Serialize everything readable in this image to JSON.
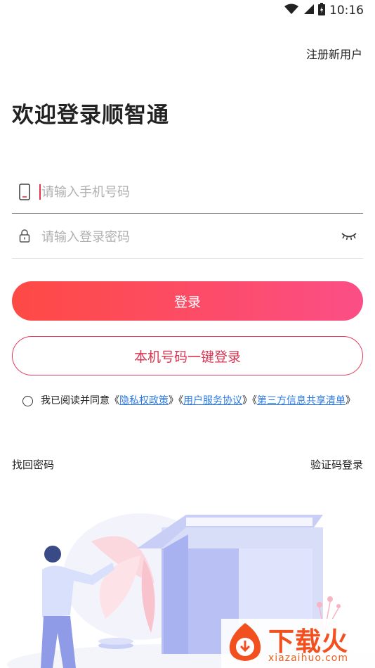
{
  "status": {
    "time": "10:16"
  },
  "header": {
    "register_label": "注册新用户"
  },
  "main": {
    "title": "欢迎登录顺智通",
    "phone_placeholder": "请输入手机号码",
    "password_placeholder": "请输入登录密码",
    "login_button": "登录",
    "quick_login_button": "本机号码一键登录"
  },
  "agreement": {
    "prefix": "我已阅读并同意《",
    "privacy_link": "隐私权政策",
    "sep1": "》《",
    "service_link": "用户服务协议",
    "sep2": "》《",
    "sharing_link": "第三方信息共享清单",
    "suffix": "》"
  },
  "footer": {
    "recover_password": "找回密码",
    "sms_login": "验证码登录"
  },
  "watermark": {
    "title": "下载火",
    "url": "xiazaihuo.com"
  },
  "colors": {
    "accent_start": "#fe4a44",
    "accent_end": "#fb4e86",
    "link": "#2c7be5",
    "outline": "#e33a5b"
  }
}
